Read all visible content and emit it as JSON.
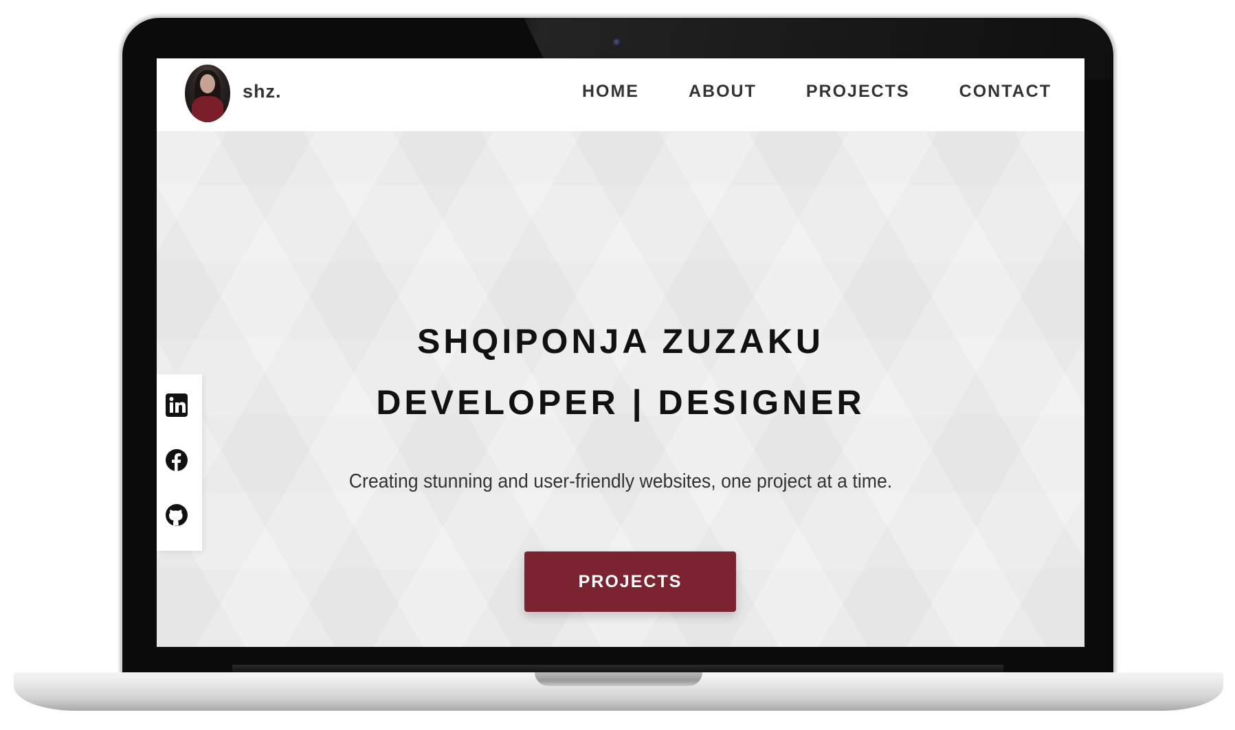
{
  "brand": {
    "name": "shz."
  },
  "nav": {
    "items": [
      {
        "label": "HOME"
      },
      {
        "label": "ABOUT"
      },
      {
        "label": "PROJECTS"
      },
      {
        "label": "CONTACT"
      }
    ]
  },
  "social": {
    "icons": [
      "linkedin-icon",
      "facebook-icon",
      "github-icon"
    ]
  },
  "hero": {
    "name": "SHQIPONJA ZUZAKU",
    "role": "DEVELOPER | DESIGNER",
    "tagline": "Creating stunning and user-friendly websites, one project at a time.",
    "cta_label": "PROJECTS"
  },
  "colors": {
    "accent": "#7b2330",
    "text": "#333333",
    "heading": "#111111",
    "background": "#f2f2f2"
  }
}
